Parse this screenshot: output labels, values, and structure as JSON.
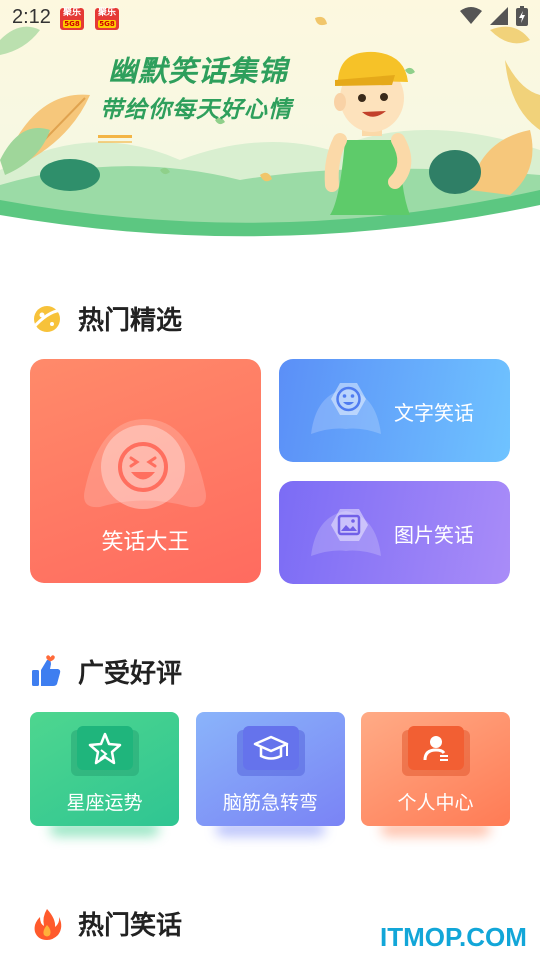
{
  "status_bar": {
    "time": "2:12",
    "notifications": [
      {
        "top": "聚乐",
        "sub": "5G8"
      },
      {
        "top": "聚乐",
        "sub": "5G8"
      }
    ],
    "icons": [
      "wifi-icon",
      "signal-icon",
      "battery-charging-icon"
    ]
  },
  "banner": {
    "title": "幽默笑话集锦",
    "subtitle": "带给你每天好心情"
  },
  "hot_picks": {
    "title": "热门精选",
    "cards": [
      {
        "label": "笑话大王",
        "icon": "laughing-face-icon"
      },
      {
        "label": "文字笑话",
        "icon": "smiley-face-icon"
      },
      {
        "label": "图片笑话",
        "icon": "image-icon"
      }
    ]
  },
  "well_received": {
    "title": "广受好评",
    "cards": [
      {
        "label": "星座运势",
        "icon": "star-icon"
      },
      {
        "label": "脑筋急转弯",
        "icon": "graduation-cap-icon"
      },
      {
        "label": "个人中心",
        "icon": "user-profile-icon"
      }
    ]
  },
  "hot_jokes": {
    "title": "热门笑话"
  },
  "watermark": "ITMOP.COM",
  "colors": {
    "accent_green": "#2e9f5c",
    "card_big": "#ff7466",
    "card_text": "#64a8fa",
    "card_pic": "#907cf6",
    "card_star": "#3ccf8e",
    "card_brain": "#7c8cf8",
    "card_profile": "#ff8a60"
  }
}
